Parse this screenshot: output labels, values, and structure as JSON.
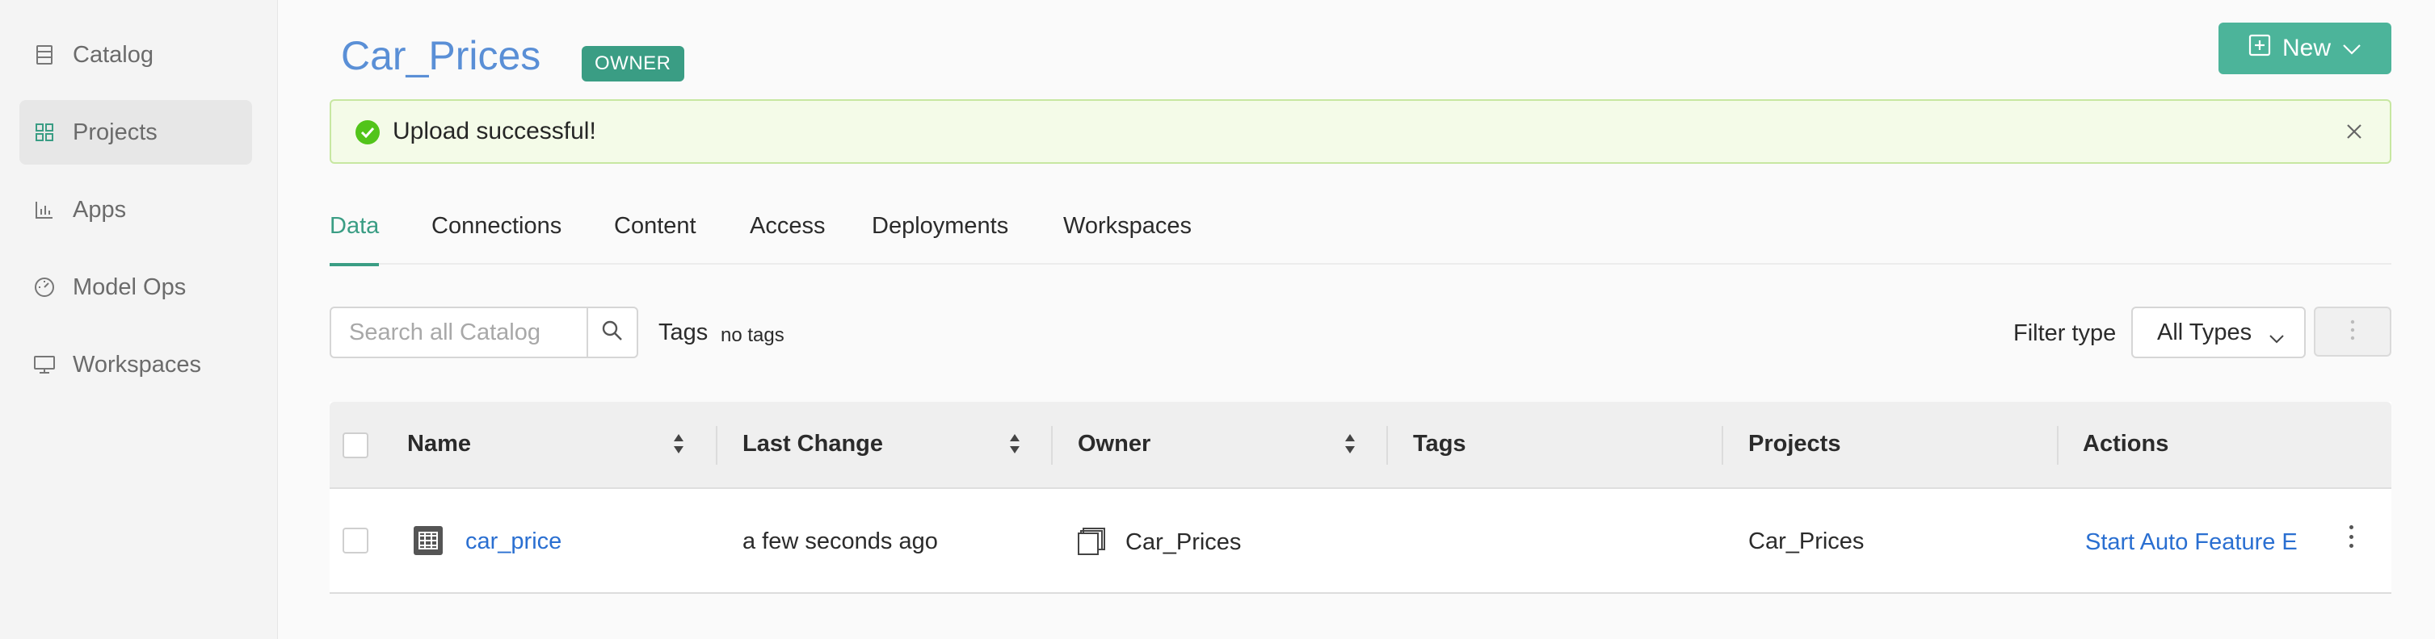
{
  "sidebar": {
    "items": [
      {
        "label": "Catalog",
        "icon": "catalog-icon",
        "active": false
      },
      {
        "label": "Projects",
        "icon": "projects-grid-icon",
        "active": true
      },
      {
        "label": "Apps",
        "icon": "apps-chart-icon",
        "active": false
      },
      {
        "label": "Model Ops",
        "icon": "gauge-icon",
        "active": false
      },
      {
        "label": "Workspaces",
        "icon": "monitor-icon",
        "active": false
      }
    ]
  },
  "header": {
    "title": "Car_Prices",
    "badge": "OWNER",
    "new_button": "New"
  },
  "alert": {
    "message": "Upload successful!"
  },
  "tabs": [
    {
      "label": "Data",
      "active": true
    },
    {
      "label": "Connections",
      "active": false
    },
    {
      "label": "Content",
      "active": false
    },
    {
      "label": "Access",
      "active": false
    },
    {
      "label": "Deployments",
      "active": false
    },
    {
      "label": "Workspaces",
      "active": false
    }
  ],
  "toolbar": {
    "search_placeholder": "Search all Catalog",
    "tags_label": "Tags",
    "tags_value": "no tags",
    "filter_label": "Filter type",
    "filter_value": "All Types"
  },
  "table": {
    "columns": [
      "Name",
      "Last Change",
      "Owner",
      "Tags",
      "Projects",
      "Actions"
    ],
    "rows": [
      {
        "name": "car_price",
        "last_change": "a few seconds ago",
        "owner": "Car_Prices",
        "tags": "",
        "projects": "Car_Prices",
        "action": "Start Auto Feature E"
      }
    ]
  },
  "colors": {
    "accent": "#3a9d84",
    "new_button": "#4cb49a",
    "title": "#5a8fd6",
    "link": "#2a6fd1",
    "alert_bg": "#f4fbe8",
    "alert_border": "#c7e7a1",
    "success": "#52c41a"
  }
}
